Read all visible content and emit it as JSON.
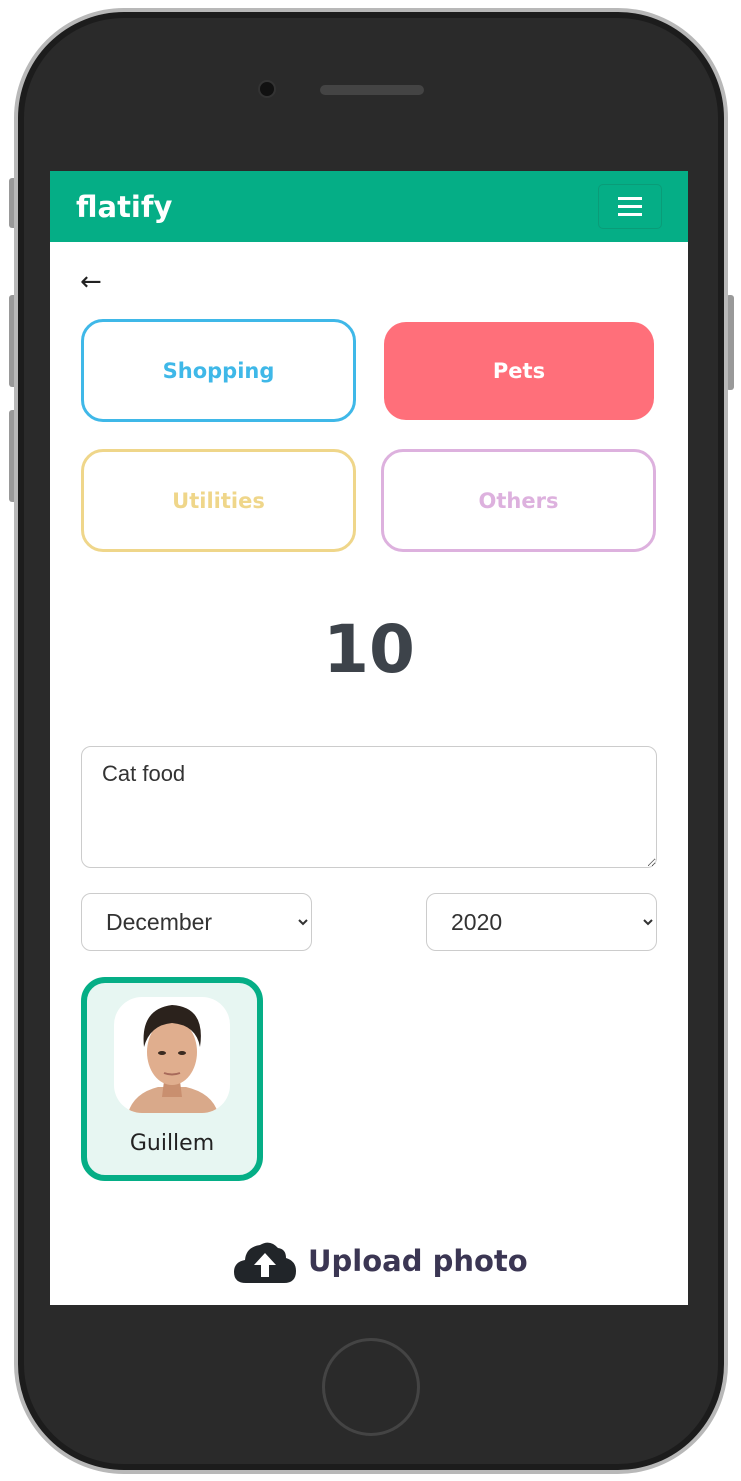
{
  "header": {
    "logo": "flatify",
    "menu_icon": "hamburger-icon"
  },
  "back_icon": "arrow-left-icon",
  "categories": [
    {
      "label": "Shopping",
      "color": "#3fb8e8",
      "selected": false
    },
    {
      "label": "Pets",
      "color": "#ff6f7a",
      "selected": true
    },
    {
      "label": "Utilities",
      "color": "#efd68a",
      "selected": false
    },
    {
      "label": "Others",
      "color": "#ddb1de",
      "selected": false
    }
  ],
  "amount": "10",
  "description": "Cat food",
  "month": "December",
  "year": "2020",
  "user": {
    "name": "Guillem",
    "selected": true
  },
  "upload": {
    "label": "Upload photo",
    "icon": "cloud-upload-icon"
  },
  "colors": {
    "brand": "#05ae86"
  }
}
